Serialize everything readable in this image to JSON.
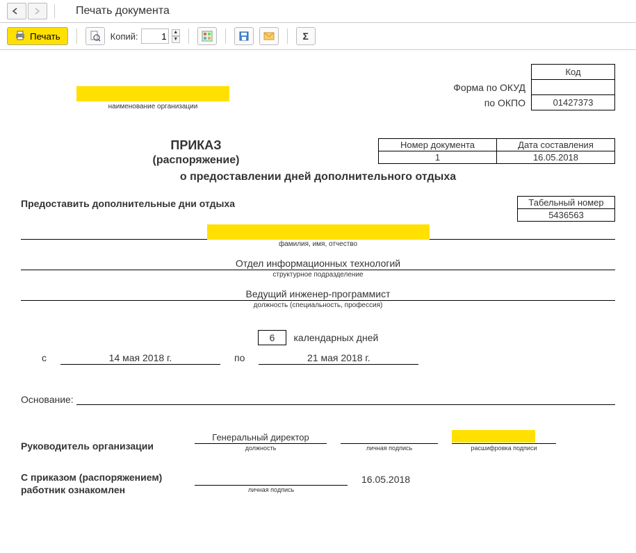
{
  "window": {
    "title": "Печать документа"
  },
  "toolbar": {
    "print_label": "Печать",
    "copies_label": "Копий:",
    "copies_value": "1",
    "sum_sign": "Σ"
  },
  "codes": {
    "code_hdr": "Код",
    "form_okud": "Форма по ОКУД",
    "okpo_label": "по ОКПО",
    "okud_value": "",
    "okpo_value": "01427373"
  },
  "org": {
    "caption": "наименование организации"
  },
  "numdate": {
    "num_hdr": "Номер документа",
    "date_hdr": "Дата составления",
    "num_value": "1",
    "date_value": "16.05.2018"
  },
  "order": {
    "title": "ПРИКАЗ",
    "sub": "(распоряжение)",
    "line2": "о предоставлении дней дополнительного отдыха"
  },
  "provide": {
    "text": "Предоставить дополнительные дни отдыха"
  },
  "tabnum": {
    "hdr": "Табельный номер",
    "value": "5436563"
  },
  "fio": {
    "caption": "фамилия, имя, отчество"
  },
  "dept": {
    "value": "Отдел информационных технологий",
    "caption": "структурное подразделение"
  },
  "position": {
    "value": "Ведущий инженер-программист",
    "caption": "должность (специальность, профессия)"
  },
  "days": {
    "count": "6",
    "unit": "календарных дней"
  },
  "dates": {
    "from_label": "с",
    "from_value": "14 мая 2018 г.",
    "to_label": "по",
    "to_value": "21 мая 2018 г."
  },
  "basis": {
    "label": "Основание:"
  },
  "head": {
    "label": "Руководитель организации",
    "position": "Генеральный директор",
    "pos_cap": "должность",
    "sign_cap": "личная подпись",
    "decode_cap": "расшифровка подписи"
  },
  "ack": {
    "label": "С приказом (распоряжением) работник  ознакомлен",
    "sign_cap": "личная подпись",
    "date": "16.05.2018"
  }
}
